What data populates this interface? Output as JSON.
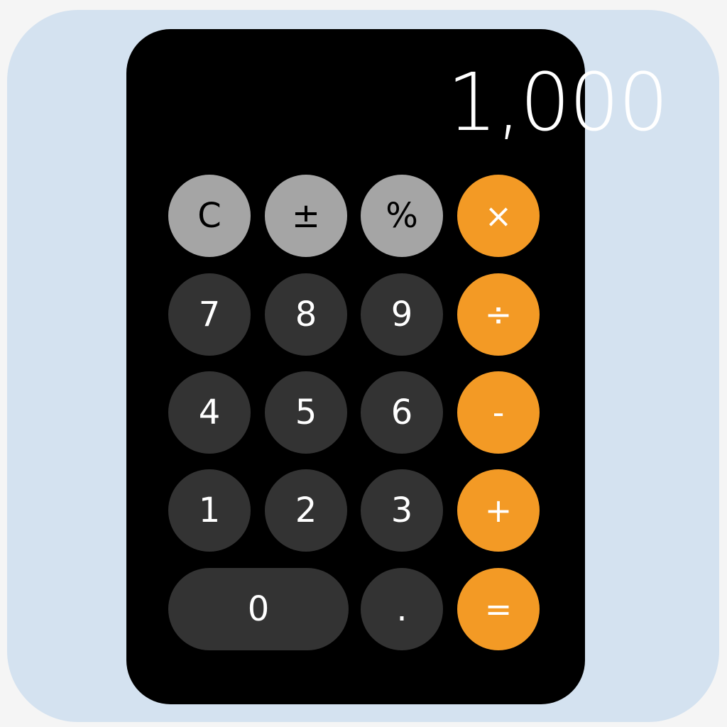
{
  "display": {
    "value": "1,000"
  },
  "keys": {
    "clear": "C",
    "sign": "±",
    "percent": "%",
    "multiply": "×",
    "seven": "7",
    "eight": "8",
    "nine": "9",
    "divide": "÷",
    "four": "4",
    "five": "5",
    "six": "6",
    "subtract": "-",
    "one": "1",
    "two": "2",
    "three": "3",
    "add": "+",
    "zero": "0",
    "decimal": ".",
    "equals": "="
  },
  "colors": {
    "backdrop": "#d4e2f0",
    "body": "#000000",
    "function_key": "#a5a5a5",
    "number_key": "#333333",
    "operator_key": "#f39a25"
  }
}
